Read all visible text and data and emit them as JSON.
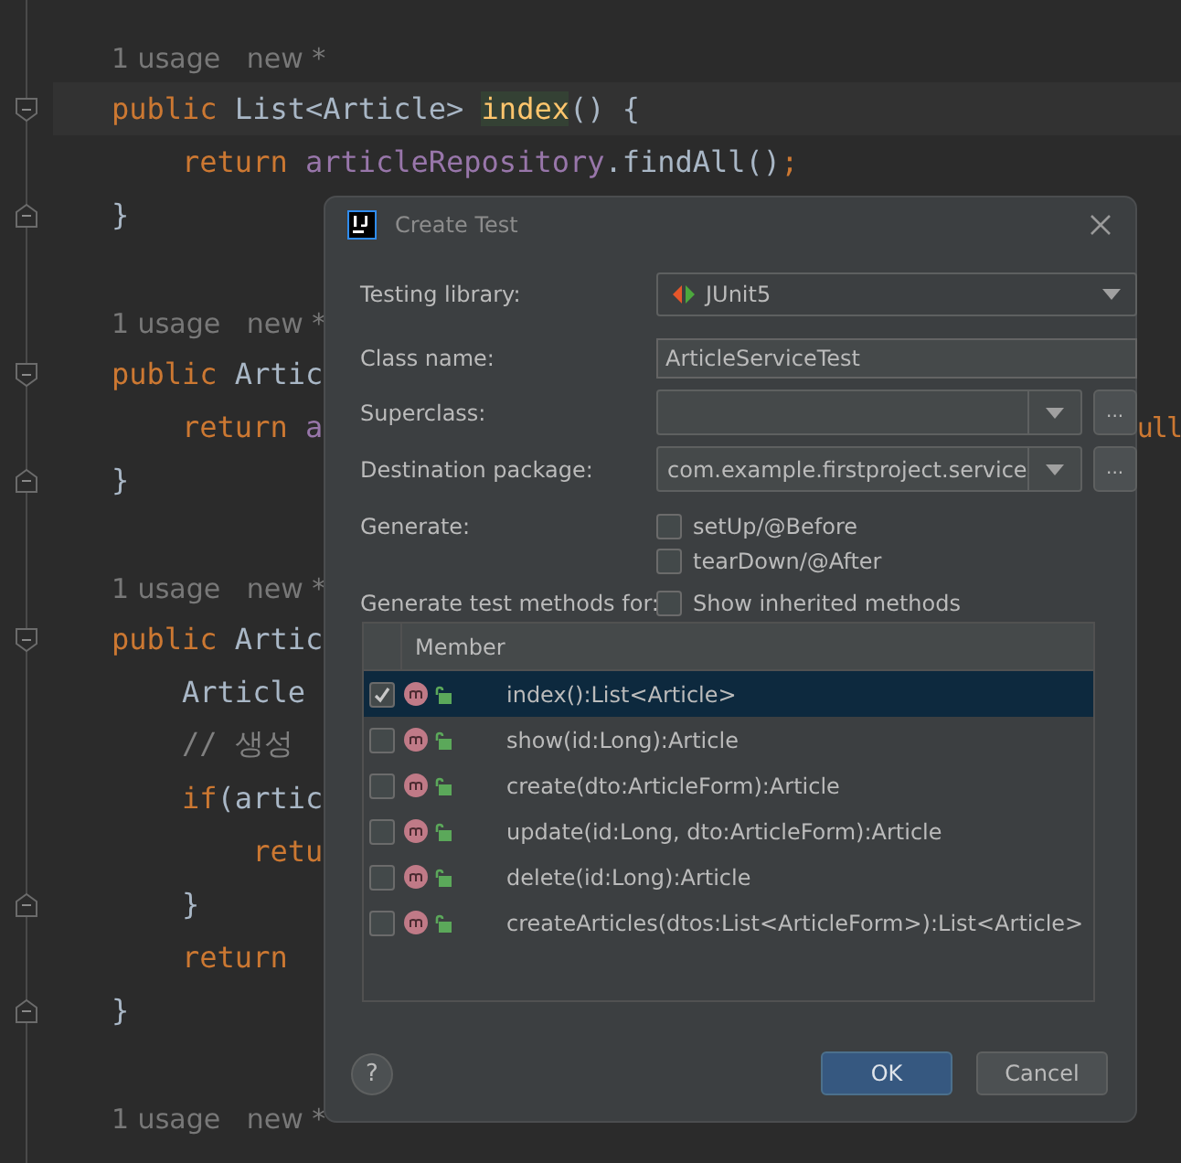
{
  "editor": {
    "lines": [
      {
        "kind": "hint",
        "segments": [
          {
            "kind": "hint",
            "text": "1 usage   new *"
          }
        ]
      },
      {
        "kind": "code",
        "current": true,
        "segments": [
          {
            "kind": "keyword",
            "text": "public"
          },
          {
            "kind": "plain",
            "text": " List<Article> "
          },
          {
            "kind": "match",
            "text": "index"
          },
          {
            "kind": "plain",
            "text": "() {"
          }
        ]
      },
      {
        "kind": "code",
        "segments": [
          {
            "kind": "keyword",
            "text": "    return "
          },
          {
            "kind": "field",
            "text": "articleRepository"
          },
          {
            "kind": "plain",
            "text": ".findAll()"
          },
          {
            "kind": "keyword",
            "text": ";"
          }
        ]
      },
      {
        "kind": "code",
        "segments": [
          {
            "kind": "plain",
            "text": "}"
          }
        ]
      },
      {
        "kind": "blank"
      },
      {
        "kind": "hint",
        "segments": [
          {
            "kind": "hint",
            "text": "1 usage   new *"
          }
        ]
      },
      {
        "kind": "code",
        "segments": [
          {
            "kind": "keyword",
            "text": "public"
          },
          {
            "kind": "plain",
            "text": " Artic"
          }
        ]
      },
      {
        "kind": "code",
        "segments": [
          {
            "kind": "keyword",
            "text": "    return "
          },
          {
            "kind": "field",
            "text": "a"
          }
        ],
        "right_segments": [
          {
            "kind": "keyword",
            "text": "ull"
          }
        ]
      },
      {
        "kind": "code",
        "segments": [
          {
            "kind": "plain",
            "text": "}"
          }
        ]
      },
      {
        "kind": "blank"
      },
      {
        "kind": "hint",
        "segments": [
          {
            "kind": "hint",
            "text": "1 usage   new *"
          }
        ]
      },
      {
        "kind": "code",
        "segments": [
          {
            "kind": "keyword",
            "text": "public"
          },
          {
            "kind": "plain",
            "text": " Artic"
          }
        ]
      },
      {
        "kind": "code",
        "segments": [
          {
            "kind": "plain",
            "text": "    Article"
          }
        ]
      },
      {
        "kind": "code",
        "segments": [
          {
            "kind": "comment",
            "text": "    // 생성"
          }
        ]
      },
      {
        "kind": "code",
        "segments": [
          {
            "kind": "keyword",
            "text": "    if"
          },
          {
            "kind": "plain",
            "text": "(artic"
          }
        ]
      },
      {
        "kind": "code",
        "segments": [
          {
            "kind": "keyword",
            "text": "        retu"
          }
        ]
      },
      {
        "kind": "code",
        "segments": [
          {
            "kind": "plain",
            "text": "    }"
          }
        ]
      },
      {
        "kind": "code",
        "segments": [
          {
            "kind": "keyword",
            "text": "    return"
          }
        ]
      },
      {
        "kind": "code",
        "segments": [
          {
            "kind": "plain",
            "text": "}"
          }
        ]
      },
      {
        "kind": "blank"
      },
      {
        "kind": "hint",
        "segments": [
          {
            "kind": "hint",
            "text": "1 usage   new *"
          }
        ]
      }
    ]
  },
  "dialog": {
    "title": "Create Test",
    "testing_library": {
      "label": "Testing library:",
      "value": "JUnit5"
    },
    "class_name": {
      "label": "Class name:",
      "value": "ArticleServiceTest"
    },
    "superclass": {
      "label": "Superclass:",
      "browse": "..."
    },
    "destination_package": {
      "label": "Destination package:",
      "value": "com.example.firstproject.service",
      "browse": "..."
    },
    "generate": {
      "label": "Generate:",
      "options": [
        {
          "label": "setUp/@Before",
          "checked": false
        },
        {
          "label": "tearDown/@After",
          "checked": false
        }
      ]
    },
    "methods_for": {
      "label": "Generate test methods for:",
      "show_inherited": {
        "label": "Show inherited methods",
        "checked": false
      }
    },
    "table": {
      "column": "Member",
      "rows": [
        {
          "name": "index():List<Article>",
          "checked": true,
          "selected": true
        },
        {
          "name": "show(id:Long):Article",
          "checked": false,
          "selected": false
        },
        {
          "name": "create(dto:ArticleForm):Article",
          "checked": false,
          "selected": false
        },
        {
          "name": "update(id:Long, dto:ArticleForm):Article",
          "checked": false,
          "selected": false
        },
        {
          "name": "delete(id:Long):Article",
          "checked": false,
          "selected": false
        },
        {
          "name": "createArticles(dtos:List<ArticleForm>):List<Article>",
          "checked": false,
          "selected": false
        }
      ]
    },
    "help": "?",
    "buttons": [
      {
        "label": "OK",
        "kind": "primary"
      },
      {
        "label": "Cancel",
        "kind": "secondary"
      }
    ]
  }
}
